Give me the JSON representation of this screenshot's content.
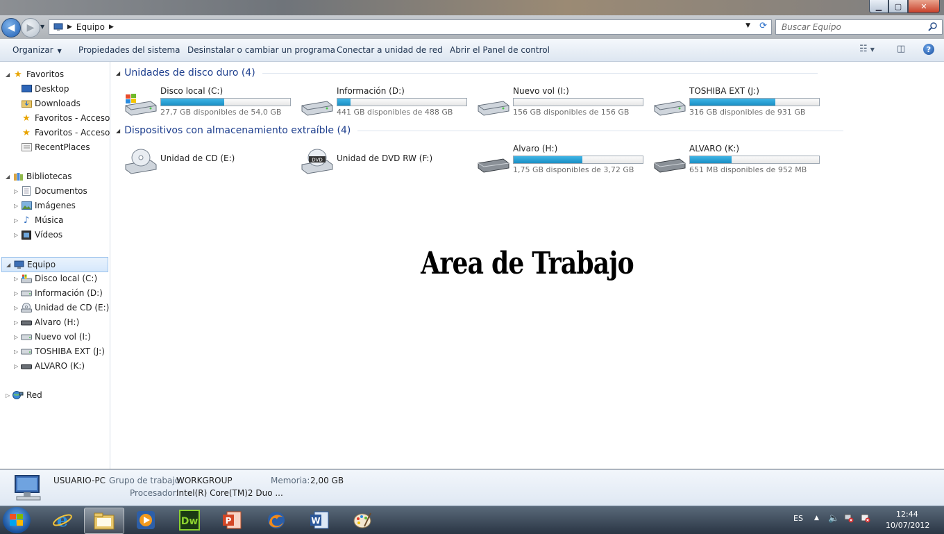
{
  "window": {
    "minimize": "▁",
    "maximize": "▢",
    "close": "✕"
  },
  "address": {
    "location": "Equipo"
  },
  "search": {
    "placeholder": "Buscar Equipo"
  },
  "commands": {
    "organize": "Organizar",
    "system_properties": "Propiedades del sistema",
    "uninstall": "Desinstalar o cambiar un programa",
    "map_drive": "Conectar a unidad de red",
    "control_panel": "Abrir el Panel de control"
  },
  "nav": {
    "favorites": {
      "label": "Favoritos",
      "items": [
        "Desktop",
        "Downloads",
        "Favoritos - Acceso d",
        "Favoritos - Acceso d",
        "RecentPlaces"
      ]
    },
    "libraries": {
      "label": "Bibliotecas",
      "items": [
        "Documentos",
        "Imágenes",
        "Música",
        "Vídeos"
      ]
    },
    "computer": {
      "label": "Equipo",
      "items": [
        "Disco local (C:)",
        "Información (D:)",
        "Unidad de CD (E:)",
        "Alvaro (H:)",
        "Nuevo vol (I:)",
        "TOSHIBA EXT (J:)",
        "ALVARO (K:)"
      ]
    },
    "network": {
      "label": "Red"
    }
  },
  "groups": {
    "hard_drives": {
      "title": "Unidades de disco duro (4)"
    },
    "removable": {
      "title": "Dispositivos con almacenamiento extraíble (4)"
    }
  },
  "hard_drives": [
    {
      "name": "Disco local (C:)",
      "free": "27,7 GB disponibles de 54,0 GB",
      "used_fraction": 0.49
    },
    {
      "name": "Información (D:)",
      "free": "441 GB disponibles de 488 GB",
      "used_fraction": 0.1
    },
    {
      "name": "Nuevo vol (I:)",
      "free": "156 GB disponibles de 156 GB",
      "used_fraction": 0.0
    },
    {
      "name": "TOSHIBA EXT (J:)",
      "free": "316 GB disponibles de 931 GB",
      "used_fraction": 0.66
    }
  ],
  "removable": [
    {
      "name": "Unidad de CD (E:)"
    },
    {
      "name": "Unidad de DVD RW (F:)"
    },
    {
      "name": "Alvaro (H:)",
      "free": "1,75 GB disponibles de 3,72 GB",
      "used_fraction": 0.53
    },
    {
      "name": "ALVARO (K:)",
      "free": "651 MB disponibles de 952 MB",
      "used_fraction": 0.32
    }
  ],
  "overlay_text": "Area de Trabajo",
  "details": {
    "computer_name": "USUARIO-PC",
    "workgroup_label": "Grupo de trabajo:",
    "workgroup_value": "WORKGROUP",
    "memory_label": "Memoria:",
    "memory_value": "2,00 GB",
    "processor_label": "Procesador:",
    "processor_value": "Intel(R) Core(TM)2 Duo ..."
  },
  "taskbar": {
    "language": "ES",
    "time": "12:44",
    "date": "10/07/2012",
    "apps": [
      "internet-explorer-icon",
      "explorer-icon",
      "media-player-icon",
      "dreamweaver-icon",
      "powerpoint-icon",
      "firefox-icon",
      "word-icon",
      "paint-icon"
    ]
  },
  "colors": {
    "accent": "#1e3f8e",
    "bar_fill": "#26a0d6"
  }
}
